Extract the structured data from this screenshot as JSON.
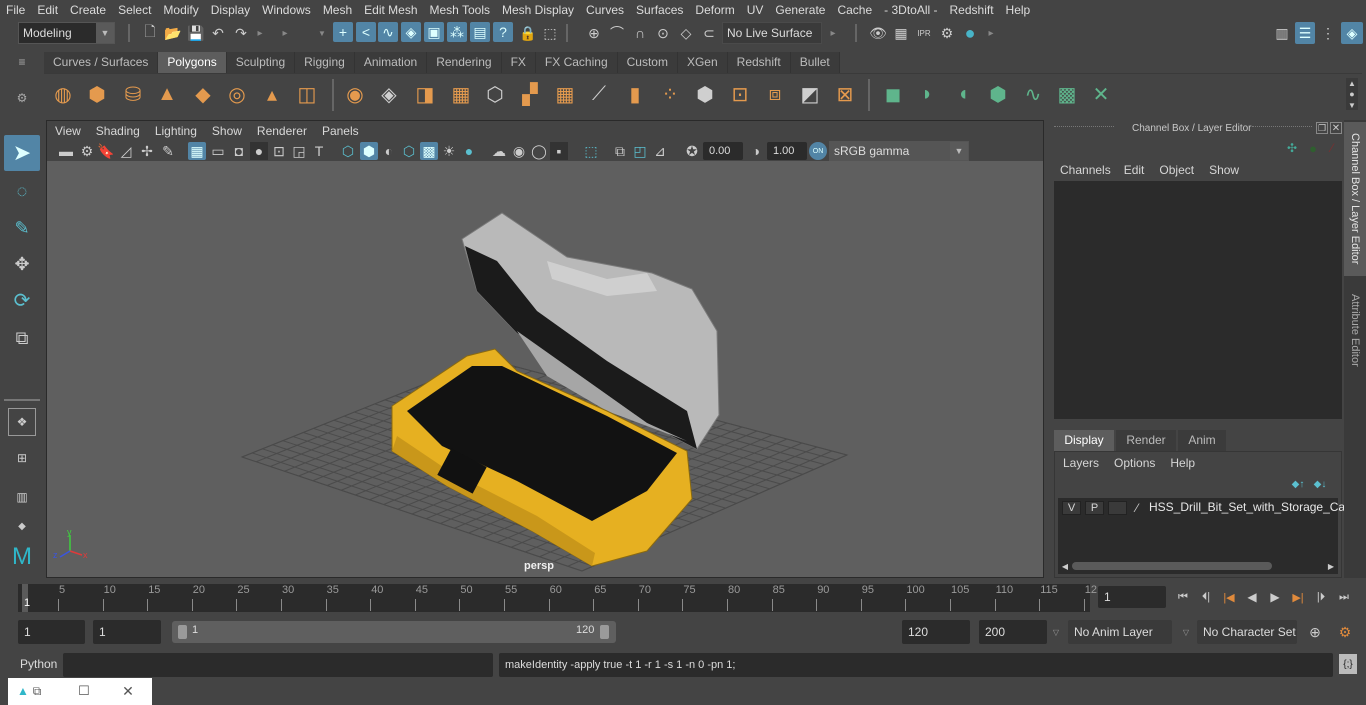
{
  "menubar": [
    "File",
    "Edit",
    "Create",
    "Select",
    "Modify",
    "Display",
    "Windows",
    "Mesh",
    "Edit Mesh",
    "Mesh Tools",
    "Mesh Display",
    "Curves",
    "Surfaces",
    "Deform",
    "UV",
    "Generate",
    "Cache",
    "- 3DtoAll -",
    "Redshift",
    "Help"
  ],
  "status_line": {
    "workspace_mode": "Modeling",
    "live_surface": "No Live Surface"
  },
  "shelf": {
    "tabs": [
      "Curves / Surfaces",
      "Polygons",
      "Sculpting",
      "Rigging",
      "Animation",
      "Rendering",
      "FX",
      "FX Caching",
      "Custom",
      "XGen",
      "Redshift",
      "Bullet"
    ],
    "active_tab": "Polygons",
    "poly_icons": [
      "poly-sphere-icon",
      "poly-cube-icon",
      "poly-cylinder-icon",
      "poly-cone-icon",
      "poly-plane-icon",
      "poly-torus-icon",
      "poly-pyramid-icon",
      "poly-pipe-icon",
      "combine-icon",
      "separate-icon",
      "mirror-icon",
      "smooth-icon",
      "bevel-icon",
      "extrude-icon",
      "bridge-icon",
      "append-icon",
      "multi-cut-icon",
      "target-weld-icon",
      "merge-icon",
      "fill-hole-icon",
      "quad-draw-icon",
      "insert-edge-loop-icon",
      "offset-edge-loop-icon",
      "split-icon",
      "reduce-icon"
    ],
    "uv_icons": [
      "planar-uv-icon",
      "cylindrical-uv-icon",
      "spherical-uv-icon",
      "automatic-uv-icon",
      "unfold-uv-icon",
      "uv-editor-icon",
      "layout-uv-icon"
    ]
  },
  "viewport": {
    "menu": [
      "View",
      "Shading",
      "Lighting",
      "Show",
      "Renderer",
      "Panels"
    ],
    "exposure": "0.00",
    "gamma": "1.00",
    "color_mgmt_toggle": "ON",
    "color_space": "sRGB gamma",
    "camera_label": "persp",
    "axis": {
      "x": "x",
      "y": "y",
      "z": "z"
    }
  },
  "channel_box": {
    "title": "Channel Box / Layer Editor",
    "menu": [
      "Channels",
      "Edit",
      "Object",
      "Show"
    ]
  },
  "layer_editor": {
    "tabs": [
      "Display",
      "Render",
      "Anim"
    ],
    "active_tab": "Display",
    "menu": [
      "Layers",
      "Options",
      "Help"
    ],
    "layers": [
      {
        "visible": "V",
        "playback": "P",
        "type": "",
        "name": "HSS_Drill_Bit_Set_with_Storage_Case_"
      }
    ]
  },
  "side_tabs": [
    "Channel Box / Layer Editor",
    "Attribute Editor"
  ],
  "timeline": {
    "ticks": [
      "5",
      "10",
      "15",
      "20",
      "25",
      "30",
      "35",
      "40",
      "45",
      "50",
      "55",
      "60",
      "65",
      "70",
      "75",
      "80",
      "85",
      "90",
      "95",
      "100",
      "105",
      "110",
      "115",
      "12"
    ],
    "current_frame_marker": "1",
    "current_frame": "1"
  },
  "range": {
    "start_time": "1",
    "playback_start": "1",
    "slider_start": "1",
    "slider_end": "120",
    "playback_end": "120",
    "end_time": "200",
    "anim_layer": "No Anim Layer",
    "character_set": "No Character Set"
  },
  "command_line": {
    "language": "Python",
    "input": "",
    "result": "makeIdentity -apply true -t 1 -r 1 -s 1 -n 0 -pn 1;"
  },
  "colors": {
    "accent_blue": "#5285a6",
    "poly_orange": "#e49a4e",
    "uv_green": "#5fb58c",
    "case_yellow": "#e6b021",
    "lid_gray": "#b9b9b9"
  }
}
